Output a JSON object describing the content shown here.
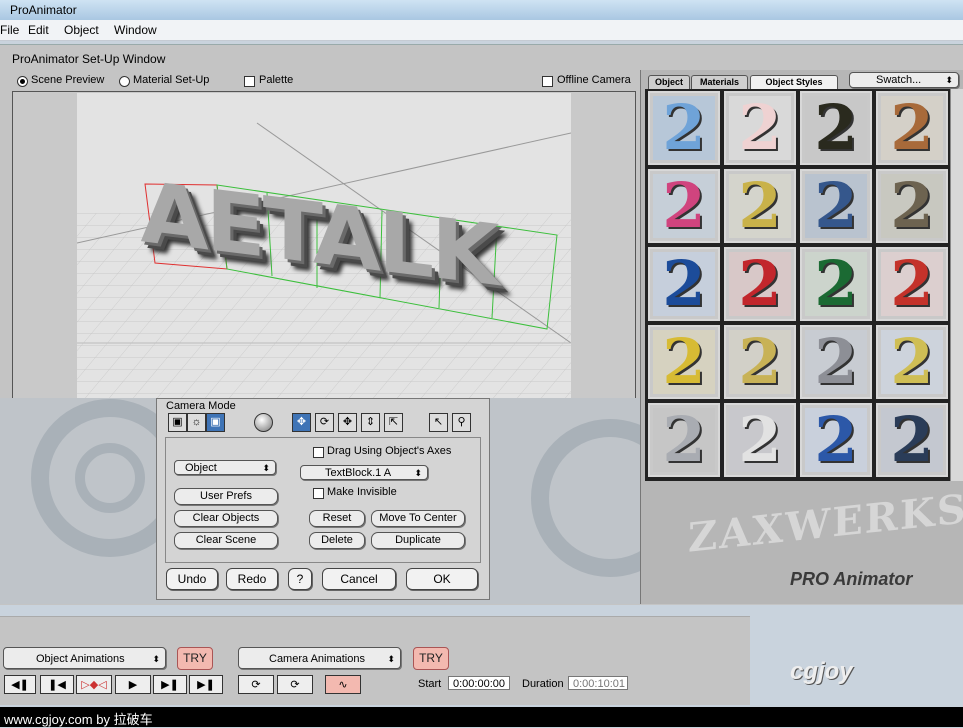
{
  "window": {
    "title": "ProAnimator"
  },
  "menu": [
    "File",
    "Edit",
    "Object",
    "Window"
  ],
  "setup": {
    "title": "ProAnimator Set-Up Window",
    "radio_scene": "Scene Preview",
    "radio_material": "Material Set-Up",
    "palette": "Palette",
    "offline_camera": "Offline Camera"
  },
  "scene": {
    "text": "AETALK"
  },
  "camera_panel": {
    "title": "Camera Mode",
    "object_popup": "Object",
    "user_prefs": "User Prefs",
    "clear_objects": "Clear Objects",
    "clear_scene": "Clear Scene",
    "drag_axes": "Drag Using Object's Axes",
    "textblock_popup": "TextBlock.1 A",
    "make_invisible": "Make Invisible",
    "reset": "Reset",
    "move_to_center": "Move To Center",
    "delete": "Delete",
    "duplicate": "Duplicate",
    "undo": "Undo",
    "redo": "Redo",
    "help": "?",
    "cancel": "Cancel",
    "ok": "OK"
  },
  "right_panel": {
    "tabs": [
      "Object",
      "Materials",
      "Object Styles"
    ],
    "swatch": "Swatch...",
    "logo_zax": "ZAXWERKS",
    "logo_pro": "PRO Animator",
    "styles": [
      {
        "glyph": "2",
        "fg": "#6fa3d8",
        "bg": "#b7c7d8"
      },
      {
        "glyph": "2",
        "fg": "#efd2d2",
        "bg": "#d9d9d9"
      },
      {
        "glyph": "2",
        "fg": "#2a2a1e",
        "bg": "#c8c8c8"
      },
      {
        "glyph": "2",
        "fg": "#a86a3a",
        "bg": "#d4d0c8"
      },
      {
        "glyph": "2",
        "fg": "#d0447e",
        "bg": "#c6cfd8"
      },
      {
        "glyph": "2",
        "fg": "#c9b24a",
        "bg": "#d4d4cc"
      },
      {
        "glyph": "2",
        "fg": "#35578c",
        "bg": "#b9c3cf"
      },
      {
        "glyph": "2",
        "fg": "#6d6350",
        "bg": "#c8c8c0"
      },
      {
        "glyph": "2",
        "fg": "#1c4c9a",
        "bg": "#c6cfdc"
      },
      {
        "glyph": "2",
        "fg": "#c2262c",
        "bg": "#d8c8c8"
      },
      {
        "glyph": "2",
        "fg": "#1b6a33",
        "bg": "#ccd4cc"
      },
      {
        "glyph": "2",
        "fg": "#c4322a",
        "bg": "#dccfcf"
      },
      {
        "glyph": "2",
        "fg": "#d7bb34",
        "bg": "#d6d2c0"
      },
      {
        "glyph": "2",
        "fg": "#c8b256",
        "bg": "#d2d0c8"
      },
      {
        "glyph": "2",
        "fg": "#8d8f96",
        "bg": "#c8ccd2"
      },
      {
        "glyph": "2",
        "fg": "#cfbe55",
        "bg": "#cdd3dc"
      },
      {
        "glyph": "2",
        "fg": "#a9acb2",
        "bg": "#c6c6c6"
      },
      {
        "glyph": "2",
        "fg": "#e2e2e2",
        "bg": "#c8c8cc"
      },
      {
        "glyph": "2",
        "fg": "#2c58a8",
        "bg": "#c9d0dc"
      },
      {
        "glyph": "2",
        "fg": "#2a3c58",
        "bg": "#c4c8d0"
      }
    ]
  },
  "timeline": {
    "object_animations": "Object Animations",
    "camera_animations": "Camera Animations",
    "try": "TRY",
    "start_label": "Start",
    "start_value": "0:00:00:00",
    "duration_label": "Duration",
    "duration_value": "0:00:10:01"
  },
  "watermark": {
    "cgjoy": "cgjoy"
  },
  "footer": {
    "text": "www.cgjoy.com by 拉破车"
  }
}
